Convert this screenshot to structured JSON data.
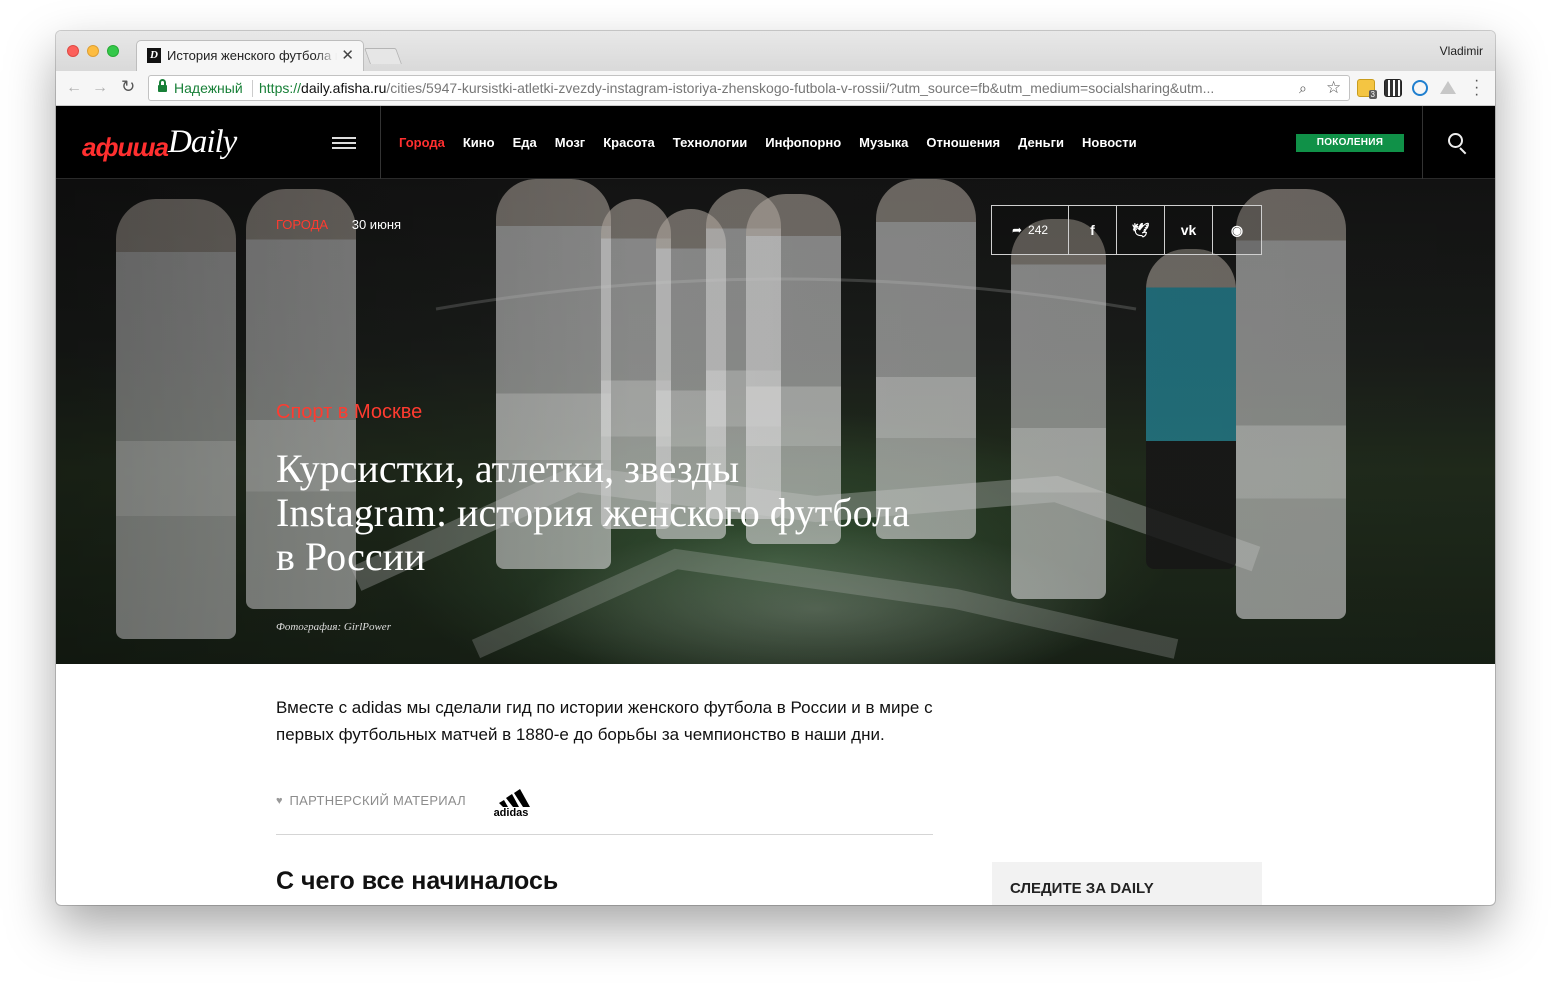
{
  "browser": {
    "tab_title": "История женского футбола в России",
    "tab_close": "✕",
    "profile_name": "Vladimir",
    "secure_label": "Надежный",
    "url_scheme": "https://",
    "url_host": "daily.afisha.ru",
    "url_path": "/cities/5947-kursistki-atletki-zvezdy-instagram-istoriya-zhenskogo-futbola-v-rossii/?utm_source=fb&utm_medium=socialsharing&utm...",
    "extension_badge": "3"
  },
  "site": {
    "logo_red": "афиша",
    "logo_white": "Daily",
    "nav": [
      "Города",
      "Кино",
      "Еда",
      "Мозг",
      "Красота",
      "Технологии",
      "Инфопорно",
      "Музыка",
      "Отношения",
      "Деньги",
      "Новости"
    ],
    "active_nav": "Города",
    "promo_label": "ПОКОЛЕНИЯ"
  },
  "hero": {
    "rubric": "ГОРОДА",
    "date": "30 июня",
    "share_count": "242",
    "kicker": "Спорт в Москве",
    "title": "Курсистки, атлетки, звезды Instagram: история женского футбола в России",
    "photo_credit": "Фотография: GirlPower"
  },
  "article": {
    "lead": "Вместе с adidas мы сделали гид по истории женского футбола в России и в мире с первых футбольных матчей в 1880-е до борьбы за чемпионство в наши дни.",
    "partner_label": "ПАРТНЕРСКИЙ МАТЕРИАЛ",
    "partner_logo": "adidas",
    "section_heading": "С чего все начиналось"
  },
  "sidebar": {
    "follow_title": "СЛЕДИТЕ ЗА DAILY"
  },
  "colors": {
    "accent_red": "#ff2f2f",
    "promo_green": "#109148",
    "secure_green": "#188038"
  }
}
